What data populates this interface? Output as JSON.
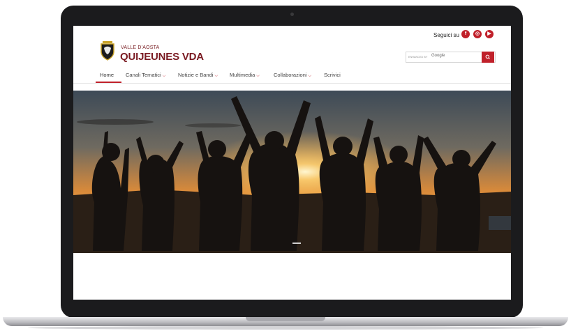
{
  "header": {
    "follow_label": "Seguici su",
    "social_icons": [
      "facebook-icon",
      "instagram-icon",
      "youtube-icon"
    ],
    "logo_small": "VALLE D'AOSTA",
    "logo_big": "QUIJEUNES VDA"
  },
  "search": {
    "enhanced_label": "ENHANCED BY",
    "google_label": "Google",
    "button_icon": "search-icon"
  },
  "nav": {
    "items": [
      {
        "label": "Home",
        "active": true,
        "dropdown": false
      },
      {
        "label": "Canali Tematici",
        "active": false,
        "dropdown": true
      },
      {
        "label": "Notizie e Bandi",
        "active": false,
        "dropdown": true
      },
      {
        "label": "Multimedia",
        "active": false,
        "dropdown": true
      },
      {
        "label": "Collaborazioni",
        "active": false,
        "dropdown": true
      },
      {
        "label": "Scrivici",
        "active": false,
        "dropdown": false
      }
    ],
    "chevron": "⌵"
  },
  "hero": {
    "slide_count": 1,
    "active_slide": 1
  },
  "colors": {
    "accent": "#c0202a",
    "brand": "#7a1a22",
    "laptop_frame": "#1b1b1d"
  }
}
